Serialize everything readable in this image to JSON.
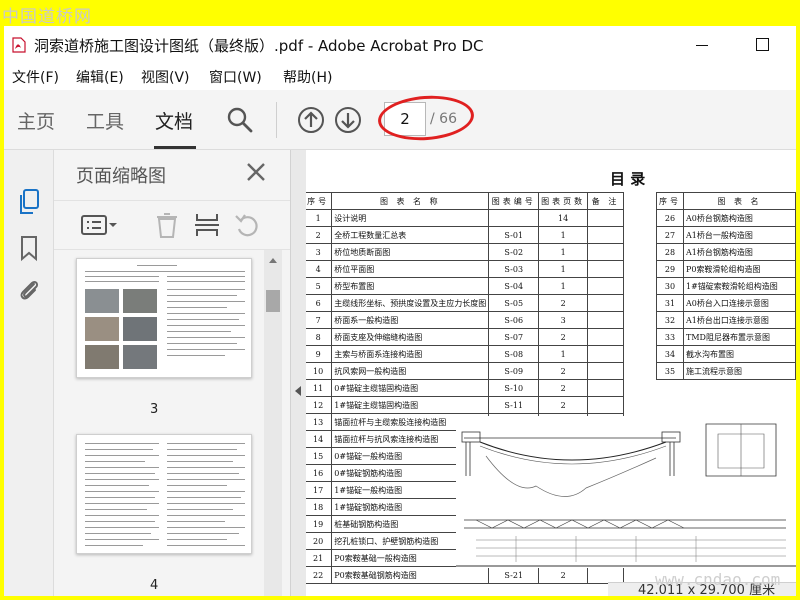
{
  "watermark": {
    "top": "中国道桥网",
    "bottom": "www.cndao.com"
  },
  "window": {
    "title": "洞索道桥施工图设计图纸（最终版）.pdf - Adobe Acrobat Pro DC",
    "icon": "pdf-icon"
  },
  "menu": [
    "文件(F)",
    "编辑(E)",
    "视图(V)",
    "窗口(W)",
    "帮助(H)"
  ],
  "toolbar": {
    "tabs": [
      "主页",
      "工具",
      "文档"
    ],
    "active_tab": "文档",
    "current_page": "2",
    "total_pages": "/ 66",
    "highlight_color": "#e02020"
  },
  "side_panel": {
    "title": "页面缩略图",
    "thumbnails": [
      {
        "label": "3"
      },
      {
        "label": "4"
      }
    ]
  },
  "document": {
    "title": "目     录",
    "left_table": {
      "headers": [
        "序号",
        "图 表 名 称",
        "图表编号",
        "图表页数",
        "备 注"
      ],
      "rows": [
        [
          "1",
          "设计说明",
          "",
          "14",
          ""
        ],
        [
          "2",
          "全桥工程数量汇总表",
          "S-01",
          "1",
          ""
        ],
        [
          "3",
          "桥位地质断面图",
          "S-02",
          "1",
          ""
        ],
        [
          "4",
          "桥位平面图",
          "S-03",
          "1",
          ""
        ],
        [
          "5",
          "桥型布置图",
          "S-04",
          "1",
          ""
        ],
        [
          "6",
          "主缆线形坐标、预拱度设置及主应力长度图",
          "S-05",
          "2",
          ""
        ],
        [
          "7",
          "桥面系一般构造图",
          "S-06",
          "3",
          ""
        ],
        [
          "8",
          "桥面支座及伸缩缝构造图",
          "S-07",
          "2",
          ""
        ],
        [
          "9",
          "主索与桥面系连接构造图",
          "S-08",
          "1",
          ""
        ],
        [
          "10",
          "抗风索网一般构造图",
          "S-09",
          "2",
          ""
        ],
        [
          "11",
          "0#锚碇主缆锚固构造图",
          "S-10",
          "2",
          ""
        ],
        [
          "12",
          "1#锚碇主缆锚固构造图",
          "S-11",
          "2",
          ""
        ],
        [
          "13",
          "锚面拉杆与主缆索股连接构造图",
          "",
          "",
          ""
        ],
        [
          "14",
          "锚面拉杆与抗风索连接构造图",
          "",
          "",
          ""
        ],
        [
          "15",
          "0#锚碇一般构造图",
          "",
          "",
          ""
        ],
        [
          "16",
          "0#锚碇钢筋构造图",
          "",
          "",
          ""
        ],
        [
          "17",
          "1#锚碇一般构造图",
          "",
          "",
          ""
        ],
        [
          "18",
          "1#锚碇钢筋构造图",
          "",
          "",
          ""
        ],
        [
          "19",
          "桩基础钢筋构造图",
          "",
          "",
          ""
        ],
        [
          "20",
          "挖孔桩锁口、护壁钢筋构造图",
          "",
          "",
          ""
        ],
        [
          "21",
          "P0索鞍基础一般构造图",
          "",
          "",
          ""
        ],
        [
          "22",
          "P0索鞍基础钢筋构造图",
          "S-21",
          "2",
          ""
        ]
      ]
    },
    "right_table": {
      "headers": [
        "序号",
        "图 表 名"
      ],
      "rows": [
        [
          "26",
          "A0桥台钢筋构造图"
        ],
        [
          "27",
          "A1桥台一般构造图"
        ],
        [
          "28",
          "A1桥台钢筋构造图"
        ],
        [
          "29",
          "P0索鞍滑轮组构造图"
        ],
        [
          "30",
          "1#锚碇索鞍滑轮组构造图"
        ],
        [
          "31",
          "A0桥台入口连接示意图"
        ],
        [
          "32",
          "A1桥台出口连接示意图"
        ],
        [
          "33",
          "TMD阻尼器布置示意图"
        ],
        [
          "34",
          "截水沟布置图"
        ],
        [
          "35",
          "施工流程示意图"
        ]
      ]
    }
  },
  "status": {
    "dimensions": "42.011 x 29.700 厘米"
  }
}
